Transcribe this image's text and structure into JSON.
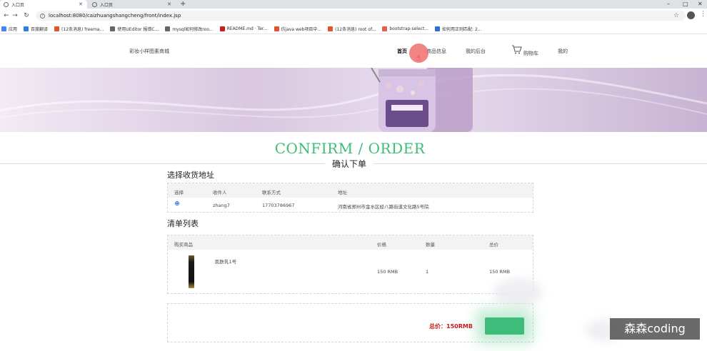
{
  "browser": {
    "tabs": [
      {
        "title": "入口页",
        "active": true
      },
      {
        "title": "入口页",
        "active": false
      }
    ],
    "new_tab": "+",
    "close": "✕",
    "url": "localhost:8080/caizhuangshangcheng/front/index.jsp",
    "window_controls": [
      "–",
      "□",
      "✕"
    ],
    "bookmarks": [
      {
        "label": "应用",
        "icon": "apps-icon",
        "color": "#4285f4"
      },
      {
        "label": "百度翻译",
        "icon": "baidu-translate-icon",
        "color": "#2f7de1"
      },
      {
        "label": "(12条消息) freema...",
        "icon": "csdn-icon",
        "color": "#e5532d"
      },
      {
        "label": "使用UEditor 报错C...",
        "icon": "page-icon",
        "color": "#666666"
      },
      {
        "label": "mysql如何修改roo...",
        "icon": "page-icon",
        "color": "#666666"
      },
      {
        "label": "README.md · Ter...",
        "icon": "gitee-icon",
        "color": "#c71d23"
      },
      {
        "label": "仿java web项目中...",
        "icon": "csdn-icon",
        "color": "#e5532d"
      },
      {
        "label": "(12条消息) root of...",
        "icon": "csdn-icon",
        "color": "#e5532d"
      },
      {
        "label": "bootstrap-select...",
        "icon": "cnblogs-icon",
        "color": "#e05f4e"
      },
      {
        "label": "如何用正则匹配: 2...",
        "icon": "zhihu-icon",
        "color": "#2f6fd0"
      }
    ]
  },
  "site": {
    "logo": "彩妆小样图素商城",
    "nav": [
      "首页",
      "商品信息",
      "我的后台",
      "购物车",
      "我的"
    ],
    "accent": "#3dbd79"
  },
  "page": {
    "title": "CONFIRM / ORDER",
    "subtitle": "确认下单",
    "address_section": "选择收货地址",
    "address_headers": [
      "选择",
      "收件人",
      "联系方式",
      "地址"
    ],
    "address_rows": [
      {
        "name": "zhang7",
        "phone": "17703786967",
        "address": "河南省郑州市金水区经八路街道文化路5号院"
      }
    ],
    "order_section": "清单列表",
    "order_headers": [
      "购买商品",
      "价格",
      "数量",
      "总价"
    ],
    "order_rows": [
      {
        "product": "肌肤乳1号",
        "price": "150 RMB",
        "qty": "1",
        "total": "150 RMB"
      }
    ],
    "total_label": "总价：150RMB"
  },
  "overlay": {
    "watermark": "森森coding"
  }
}
